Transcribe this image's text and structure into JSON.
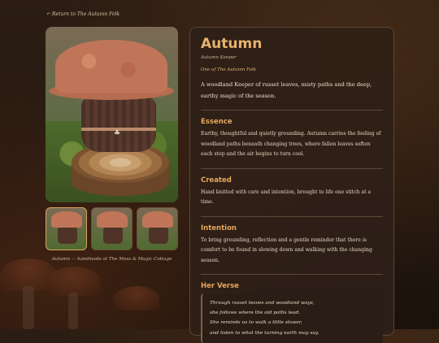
{
  "nav": {
    "back_label": "↶ Return to The Autumn Folk"
  },
  "gallery": {
    "caption": "Autumn — handmade at The Moss & Magic Cottage",
    "thumbnails": 3
  },
  "profile": {
    "title": "Autumn",
    "subtitle": "Autumn Keeper",
    "collection": "One of The Autumn Folk",
    "intro": "A woodland Keeper of russet leaves, misty paths and the deep, earthy magic of the season."
  },
  "sections": [
    {
      "heading": "Essence",
      "body": "Earthy, thoughtful and quietly grounding. Autumn carries the feeling of woodland paths beneath changing trees, where fallen leaves soften each step and the air begins to turn cool."
    },
    {
      "heading": "Created",
      "body": "Hand knitted with care and intention, brought to life one stitch at a time."
    },
    {
      "heading": "Intention",
      "body": "To bring grounding, reflection and a gentle reminder that there is comfort to be found in slowing down and walking with the changing season."
    }
  ],
  "verse": {
    "heading": "Her Verse",
    "lines": [
      "Through russet leaves and woodland ways,",
      "she follows where the old paths lead.",
      "She reminds us to walk a little slower,",
      "and listen to what the turning earth may say."
    ]
  },
  "colors": {
    "accent": "#e7a75c",
    "background": "#231710",
    "card": "#2e2018"
  }
}
